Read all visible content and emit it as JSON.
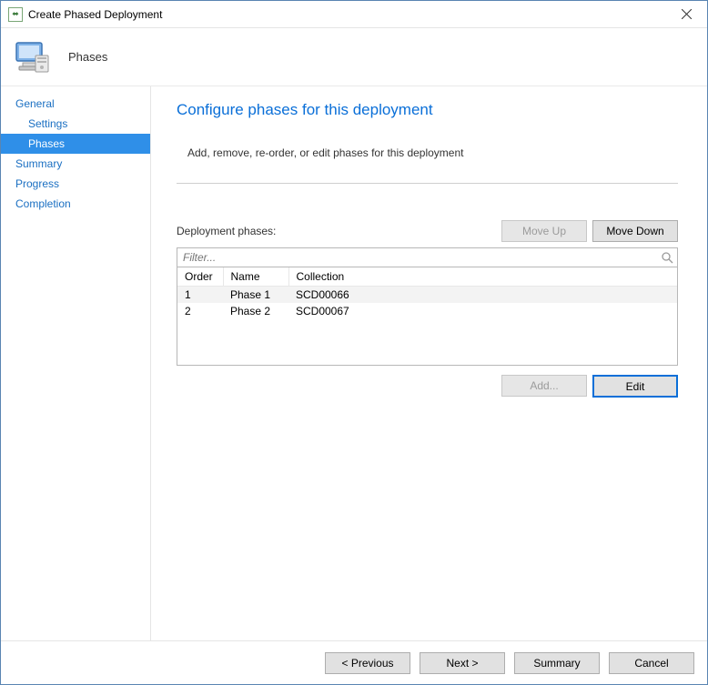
{
  "window": {
    "title": "Create Phased Deployment",
    "step_name": "Phases"
  },
  "sidebar": {
    "items": [
      {
        "label": "General",
        "child": false,
        "selected": false
      },
      {
        "label": "Settings",
        "child": true,
        "selected": false
      },
      {
        "label": "Phases",
        "child": true,
        "selected": true
      },
      {
        "label": "Summary",
        "child": false,
        "selected": false
      },
      {
        "label": "Progress",
        "child": false,
        "selected": false
      },
      {
        "label": "Completion",
        "child": false,
        "selected": false
      }
    ]
  },
  "main": {
    "heading": "Configure phases for this deployment",
    "instruction": "Add, remove, re-order, or edit phases for this deployment",
    "phases_label": "Deployment phases:",
    "move_up": "Move Up",
    "move_down": "Move Down",
    "filter_placeholder": "Filter...",
    "columns": {
      "order": "Order",
      "name": "Name",
      "collection": "Collection"
    },
    "rows": [
      {
        "order": "1",
        "name": "Phase 1",
        "collection": "SCD00066",
        "selected": true
      },
      {
        "order": "2",
        "name": "Phase 2",
        "collection": "SCD00067",
        "selected": false
      }
    ],
    "add": "Add...",
    "edit": "Edit"
  },
  "footer": {
    "previous": "< Previous",
    "next": "Next >",
    "summary": "Summary",
    "cancel": "Cancel"
  }
}
